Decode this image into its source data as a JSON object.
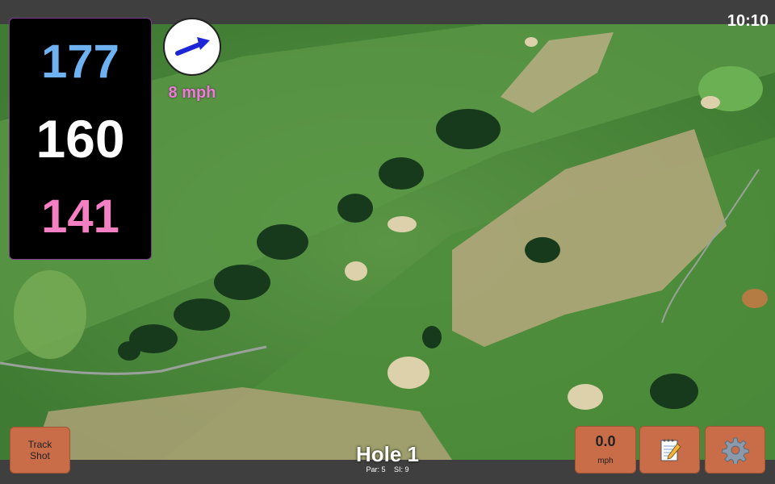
{
  "status": {
    "time": "10:10"
  },
  "yardages": {
    "back": "177",
    "middle": "160",
    "front": "141"
  },
  "wind": {
    "speed": "8 mph",
    "direction_icon": "arrow-icon"
  },
  "hole": {
    "title": "Hole 1",
    "par": "Par: 5",
    "si": "SI: 9"
  },
  "buttons": {
    "track_line1": "Track",
    "track_line2": "Shot",
    "speed_value": "0.0",
    "speed_unit": "mph",
    "notes_icon": "notepad-icon",
    "settings_icon": "gear-icon"
  },
  "colors": {
    "back_yardage": "#6eb2f2",
    "middle_yardage": "#ffffff",
    "front_yardage": "#f47fc2",
    "button_bg": "#c96c48"
  }
}
